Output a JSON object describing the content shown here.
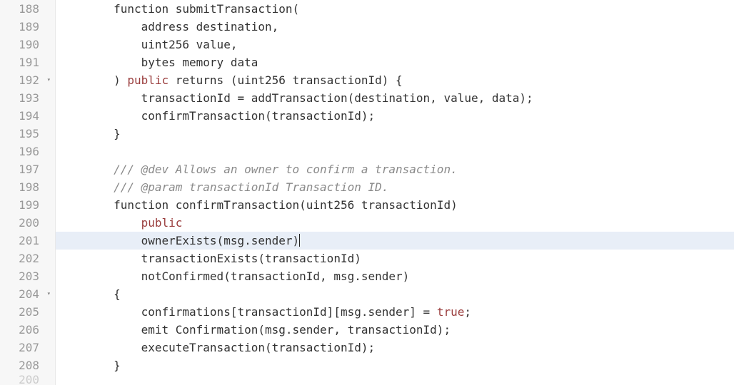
{
  "editor": {
    "first_line": 188,
    "active_line": 201,
    "fold_lines": [
      192,
      204
    ],
    "lines": [
      {
        "n": 188,
        "segments": [
          {
            "t": "        function submitTransaction(",
            "c": "tok-default"
          }
        ]
      },
      {
        "n": 189,
        "segments": [
          {
            "t": "            address destination,",
            "c": "tok-default"
          }
        ]
      },
      {
        "n": 190,
        "segments": [
          {
            "t": "            uint256 value,",
            "c": "tok-default"
          }
        ]
      },
      {
        "n": 191,
        "segments": [
          {
            "t": "            bytes memory data",
            "c": "tok-default"
          }
        ]
      },
      {
        "n": 192,
        "segments": [
          {
            "t": "        ) ",
            "c": "tok-default"
          },
          {
            "t": "public",
            "c": "tok-keyword"
          },
          {
            "t": " returns (uint256 transactionId) {",
            "c": "tok-default"
          }
        ]
      },
      {
        "n": 193,
        "segments": [
          {
            "t": "            transactionId = addTransaction(destination, value, data);",
            "c": "tok-default"
          }
        ]
      },
      {
        "n": 194,
        "segments": [
          {
            "t": "            confirmTransaction(transactionId);",
            "c": "tok-default"
          }
        ]
      },
      {
        "n": 195,
        "segments": [
          {
            "t": "        }",
            "c": "tok-default"
          }
        ]
      },
      {
        "n": 196,
        "segments": [
          {
            "t": "",
            "c": "tok-default"
          }
        ]
      },
      {
        "n": 197,
        "segments": [
          {
            "t": "        ",
            "c": "tok-default"
          },
          {
            "t": "/// @dev Allows an owner to confirm a transaction.",
            "c": "tok-comment"
          }
        ]
      },
      {
        "n": 198,
        "segments": [
          {
            "t": "        ",
            "c": "tok-default"
          },
          {
            "t": "/// @param transactionId Transaction ID.",
            "c": "tok-comment"
          }
        ]
      },
      {
        "n": 199,
        "segments": [
          {
            "t": "        function confirmTransaction(uint256 transactionId)",
            "c": "tok-default"
          }
        ]
      },
      {
        "n": 200,
        "segments": [
          {
            "t": "            ",
            "c": "tok-default"
          },
          {
            "t": "public",
            "c": "tok-keyword"
          }
        ]
      },
      {
        "n": 201,
        "segments": [
          {
            "t": "            ownerExists(msg.sender)",
            "c": "tok-default"
          },
          {
            "t": "<CURSOR>",
            "c": "cursor-marker"
          }
        ]
      },
      {
        "n": 202,
        "segments": [
          {
            "t": "            transactionExists(transactionId)",
            "c": "tok-default"
          }
        ]
      },
      {
        "n": 203,
        "segments": [
          {
            "t": "            notConfirmed(transactionId, msg.sender)",
            "c": "tok-default"
          }
        ]
      },
      {
        "n": 204,
        "segments": [
          {
            "t": "        {",
            "c": "tok-default"
          }
        ]
      },
      {
        "n": 205,
        "segments": [
          {
            "t": "            confirmations[transactionId][msg.sender] = ",
            "c": "tok-default"
          },
          {
            "t": "true",
            "c": "tok-bool"
          },
          {
            "t": ";",
            "c": "tok-default"
          }
        ]
      },
      {
        "n": 206,
        "segments": [
          {
            "t": "            emit Confirmation(msg.sender, transactionId);",
            "c": "tok-default"
          }
        ]
      },
      {
        "n": 207,
        "segments": [
          {
            "t": "            executeTransaction(transactionId);",
            "c": "tok-default"
          }
        ]
      },
      {
        "n": 208,
        "segments": [
          {
            "t": "        }",
            "c": "tok-default"
          }
        ]
      }
    ],
    "partial_next_line_number_glyph": "200"
  }
}
